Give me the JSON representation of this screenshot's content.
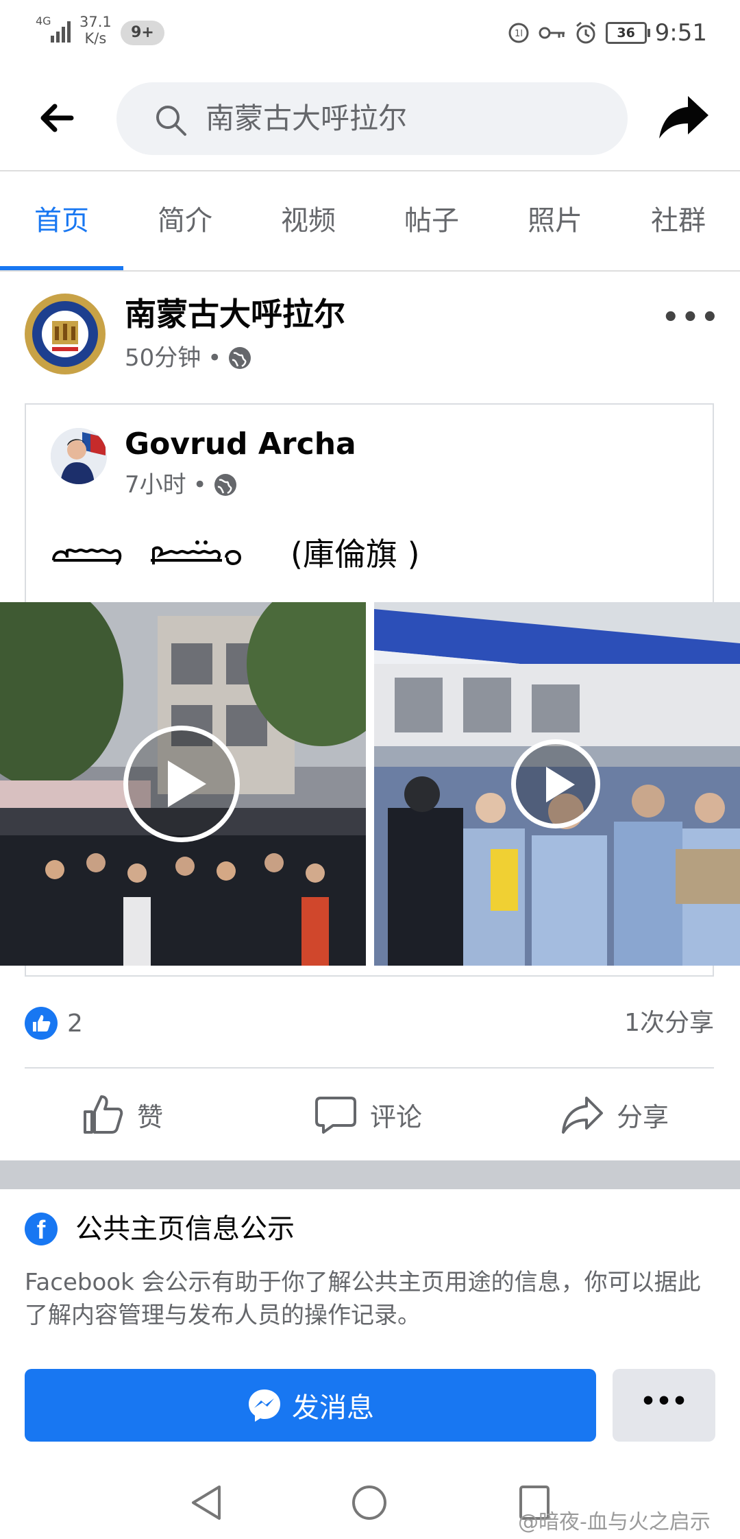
{
  "status_bar": {
    "network": "4G",
    "speed_value": "37.1",
    "speed_unit": "K/s",
    "notification_badge": "9+",
    "battery": "36",
    "time": "9:51"
  },
  "search": {
    "query": "南蒙古大呼拉尔"
  },
  "tabs": [
    {
      "label": "首页",
      "active": true
    },
    {
      "label": "简介"
    },
    {
      "label": "视频"
    },
    {
      "label": "帖子"
    },
    {
      "label": "照片"
    },
    {
      "label": "社群"
    }
  ],
  "post": {
    "page_name": "南蒙古大呼拉尔",
    "time": "50分钟",
    "shared": {
      "author": "Govrud Archa",
      "time": "7小时",
      "text_suffix": "(庫倫旗 )"
    },
    "likes": "2",
    "shares": "1次分享",
    "actions": {
      "like": "赞",
      "comment": "评论",
      "share": "分享"
    }
  },
  "transparency": {
    "title": "公共主页信息公示",
    "description": "Facebook 会公示有助于你了解公共主页用途的信息，你可以据此了解内容管理与发布人员的操作记录。",
    "message_button": "发消息"
  },
  "watermark": "@暗夜-血与火之启示",
  "colors": {
    "accent": "#1877f2",
    "secondary_text": "#65676b",
    "divider": "#dadde1"
  }
}
